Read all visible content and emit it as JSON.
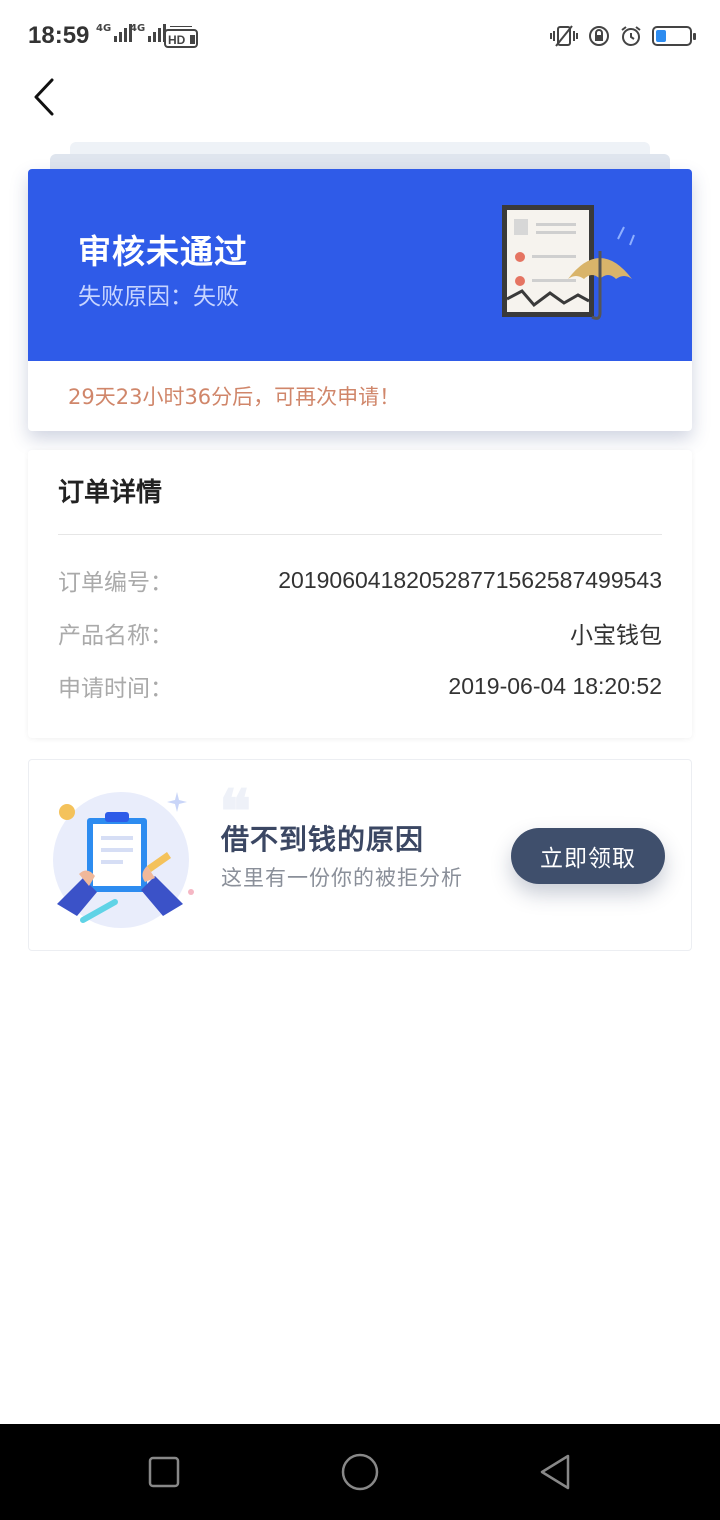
{
  "status_bar": {
    "time": "18:59",
    "signal1_tag": "4G",
    "signal2_tag": "4G",
    "hd_label": "HD",
    "battery_level": 0.25,
    "icons": [
      "vibrate-icon",
      "rotation-lock-icon",
      "alarm-icon",
      "battery-icon"
    ]
  },
  "status_card": {
    "title": "审核未通过",
    "reason": "失败原因：失败",
    "retry_text": "29天23小时36分后，可再次申请！",
    "header_color": "#2f5be8"
  },
  "order": {
    "title": "订单详情",
    "rows": [
      {
        "label": "订单编号：",
        "value": "20190604182052877156258749954 3"
      },
      {
        "label": "产品名称：",
        "value": "小宝钱包"
      },
      {
        "label": "申请时间：",
        "value": "2019-06-04 18:20:52"
      }
    ]
  },
  "promo": {
    "title": "借不到钱的原因",
    "subtitle": "这里有一份你的被拒分析",
    "button_label": "立即领取",
    "button_color": "#3f4f6c"
  },
  "nav_bar": {
    "icons": [
      "recent-apps-icon",
      "home-icon",
      "back-nav-icon"
    ]
  }
}
